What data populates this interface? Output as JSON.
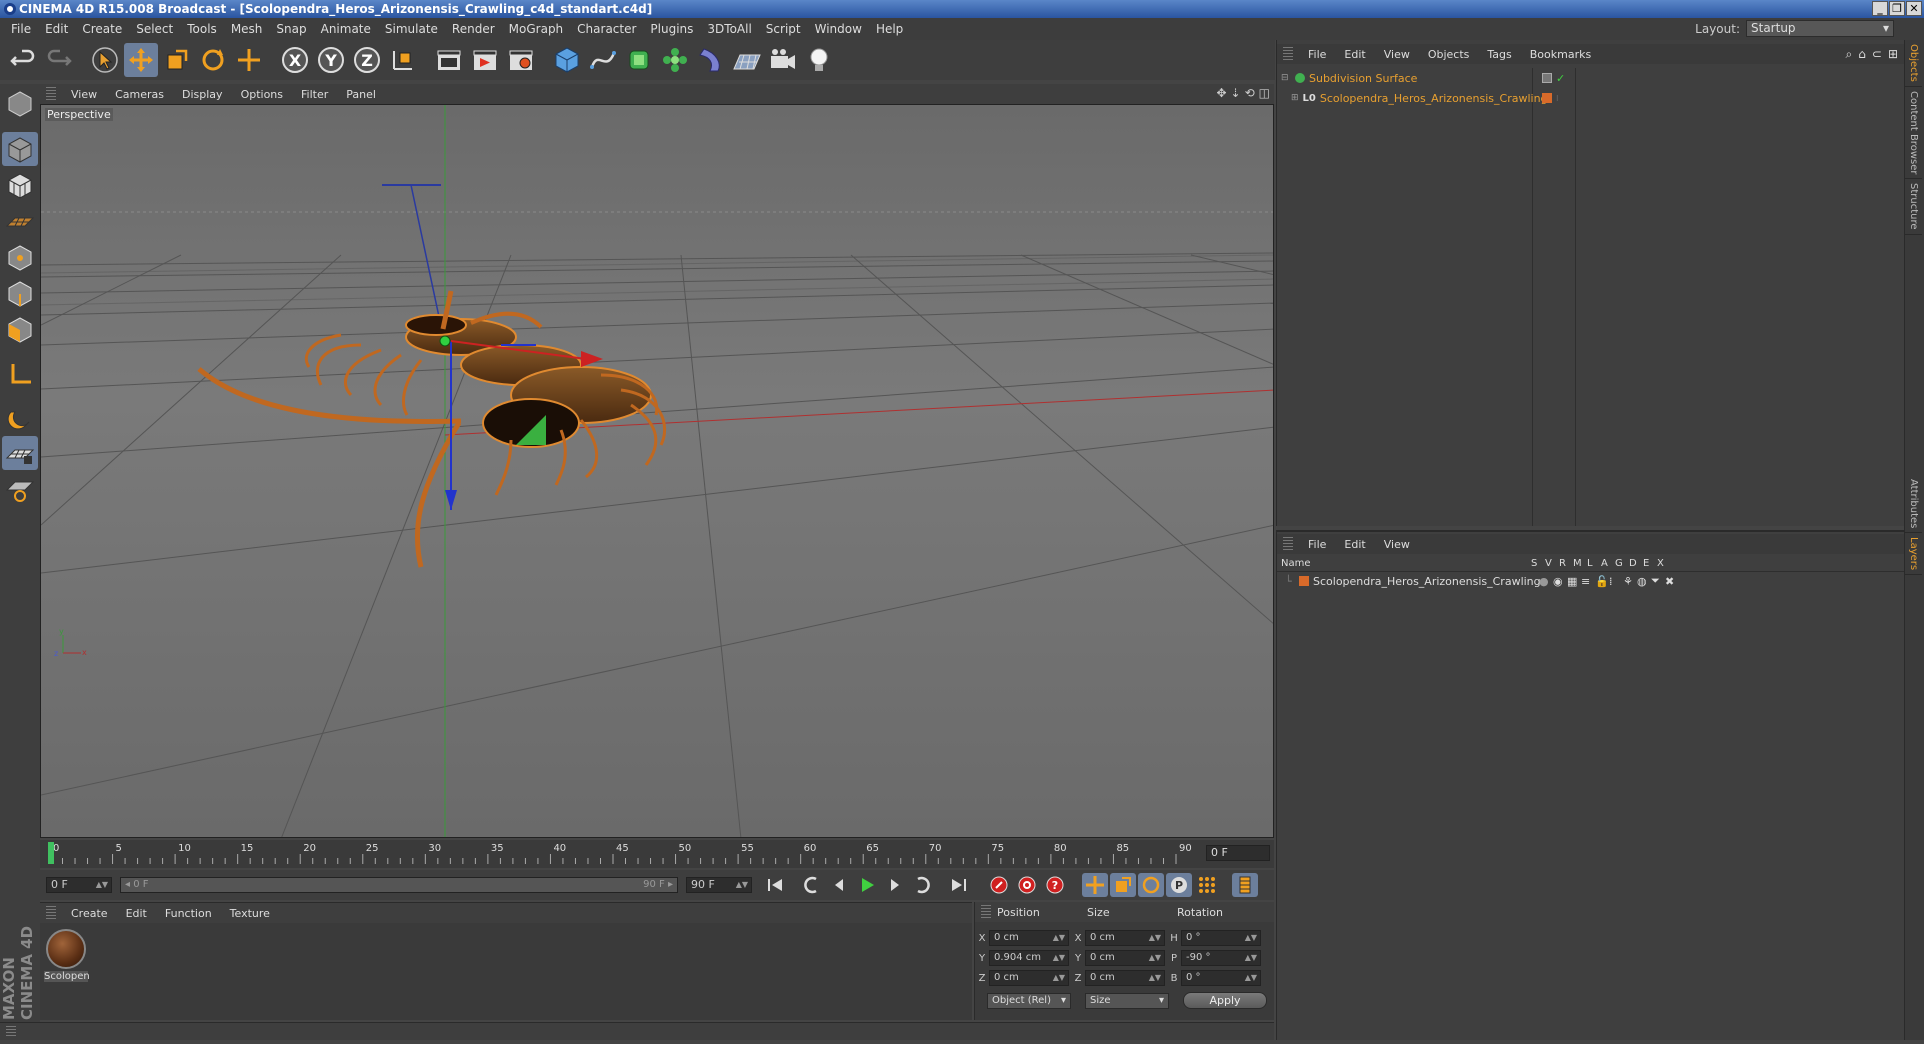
{
  "window": {
    "title": "CINEMA 4D R15.008 Broadcast - [Scolopendra_Heros_Arizonensis_Crawling_c4d_standart.c4d]",
    "buttons": [
      "_",
      "❐",
      "✕"
    ]
  },
  "menubar": [
    "File",
    "Edit",
    "Create",
    "Select",
    "Tools",
    "Mesh",
    "Snap",
    "Animate",
    "Simulate",
    "Render",
    "MoGraph",
    "Character",
    "Plugins",
    "3DToAll",
    "Script",
    "Window",
    "Help"
  ],
  "layout": {
    "label": "Layout:",
    "value": "Startup"
  },
  "viewport": {
    "menu": [
      "View",
      "Cameras",
      "Display",
      "Options",
      "Filter",
      "Panel"
    ],
    "label": "Perspective",
    "axis_letters": {
      "y": "y",
      "z": "z",
      "x": "x"
    }
  },
  "timeline": {
    "ticks": [
      "0",
      "5",
      "10",
      "15",
      "20",
      "25",
      "30",
      "35",
      "40",
      "45",
      "50",
      "55",
      "60",
      "65",
      "70",
      "75",
      "80",
      "85",
      "90"
    ],
    "current_frame_field": "0 F",
    "max_ticks": 90
  },
  "transport": {
    "start_field": "0 F",
    "range_start": "◂ 0 F",
    "range_end": "90 F ▸",
    "end_field": "90 F"
  },
  "material_panel": {
    "menu": [
      "Create",
      "Edit",
      "Function",
      "Texture"
    ],
    "material_name": "Scolopen"
  },
  "coord_panel": {
    "headers": [
      "Position",
      "Size",
      "Rotation"
    ],
    "rows": [
      {
        "axis": "X",
        "pos": "0 cm",
        "saxis": "X",
        "size": "0 cm",
        "raxis": "H",
        "rot": "0 °"
      },
      {
        "axis": "Y",
        "pos": "0.904 cm",
        "saxis": "Y",
        "size": "0 cm",
        "raxis": "P",
        "rot": "-90 °"
      },
      {
        "axis": "Z",
        "pos": "0 cm",
        "saxis": "Z",
        "size": "0 cm",
        "raxis": "B",
        "rot": "0 °"
      }
    ],
    "mode_dropdown": "Object (Rel)",
    "size_dropdown": "Size",
    "apply_button": "Apply"
  },
  "object_manager": {
    "menu": [
      "File",
      "Edit",
      "View",
      "Objects",
      "Tags",
      "Bookmarks"
    ],
    "objects": [
      {
        "name": "Subdivision Surface",
        "indent": 0
      },
      {
        "name": "Scolopendra_Heros_Arizonensis_Crawling",
        "indent": 1
      }
    ]
  },
  "layer_manager": {
    "menu": [
      "File",
      "Edit",
      "View"
    ],
    "headers": {
      "name": "Name",
      "cols": [
        "S",
        "V",
        "R",
        "M",
        "L",
        "A",
        "G",
        "D",
        "E",
        "X"
      ]
    },
    "layer": "Scolopendra_Heros_Arizonensis_Crawling"
  },
  "right_tabs": {
    "top": [
      "Objects",
      "Content Browser",
      "Structure"
    ],
    "bottom": [
      "Attributes",
      "Layers"
    ]
  },
  "colors": {
    "accent_orange": "#e8a030",
    "layer_orange": "#d86a2a",
    "viewport_bg": "#6e6e6e"
  }
}
